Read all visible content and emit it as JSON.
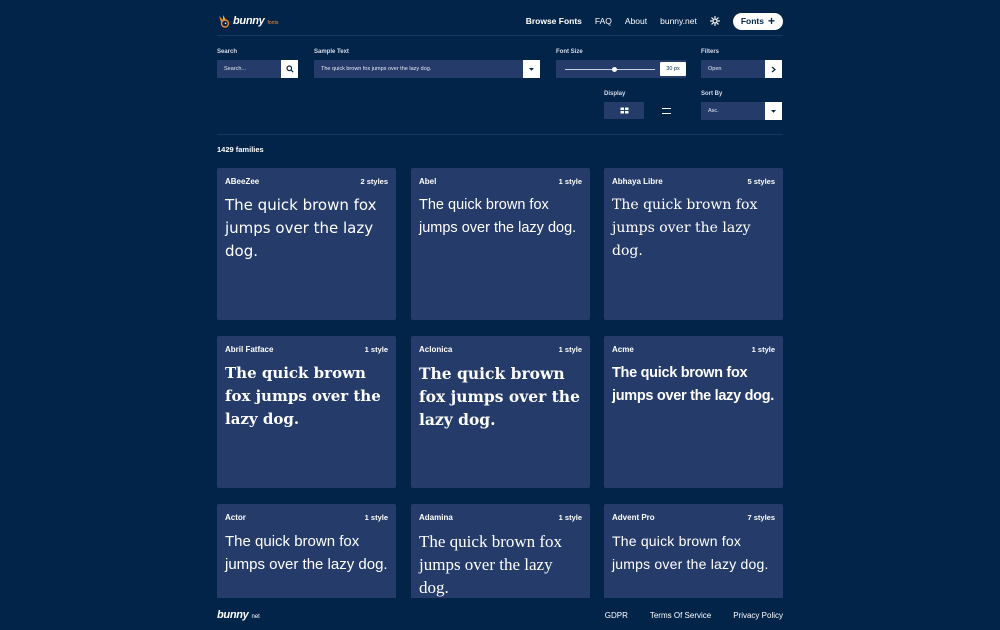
{
  "header": {
    "logo_text": "bunny",
    "logo_sub": "fonts",
    "nav": [
      "Browse Fonts",
      "FAQ",
      "About",
      "bunny.net"
    ],
    "fonts_button": "Fonts"
  },
  "controls": {
    "search_label": "Search",
    "search_placeholder": "Search...",
    "sample_label": "Sample Text",
    "sample_value": "The quick brown fox jumps over the lazy dog.",
    "size_label": "Font Size",
    "size_value": "30 px",
    "size_fraction": 0.55,
    "filters_label": "Filters",
    "filters_value": "Open",
    "display_label": "Display",
    "sort_label": "Sort By",
    "sort_value": "Asc."
  },
  "count": "1429 families",
  "cards": [
    {
      "name": "ABeeZee",
      "styles": "2 styles",
      "sample": "The quick brown fox jumps over the lazy dog."
    },
    {
      "name": "Abel",
      "styles": "1 style",
      "sample": "The quick brown fox jumps over the lazy dog."
    },
    {
      "name": "Abhaya Libre",
      "styles": "5 styles",
      "sample": "The quick brown fox jumps over the lazy dog."
    },
    {
      "name": "Abril Fatface",
      "styles": "1 style",
      "sample": "The quick brown fox jumps over the lazy dog."
    },
    {
      "name": "Aclonica",
      "styles": "1 style",
      "sample": "The quick brown fox jumps over the lazy dog."
    },
    {
      "name": "Acme",
      "styles": "1 style",
      "sample": "The quick brown fox jumps over the lazy dog."
    },
    {
      "name": "Actor",
      "styles": "1 style",
      "sample": "The quick brown fox jumps over the lazy dog."
    },
    {
      "name": "Adamina",
      "styles": "1 style",
      "sample": "The quick brown fox jumps over the lazy dog."
    },
    {
      "name": "Advent Pro",
      "styles": "7 styles",
      "sample": "The quick brown fox jumps over the lazy dog."
    }
  ],
  "footer": {
    "logo_text": "bunny",
    "logo_sub": "net",
    "links": [
      "GDPR",
      "Terms Of Service",
      "Privacy Policy"
    ]
  },
  "colors": {
    "background": "#022449",
    "card": "#253b6a",
    "accent": "#f28b2a"
  }
}
